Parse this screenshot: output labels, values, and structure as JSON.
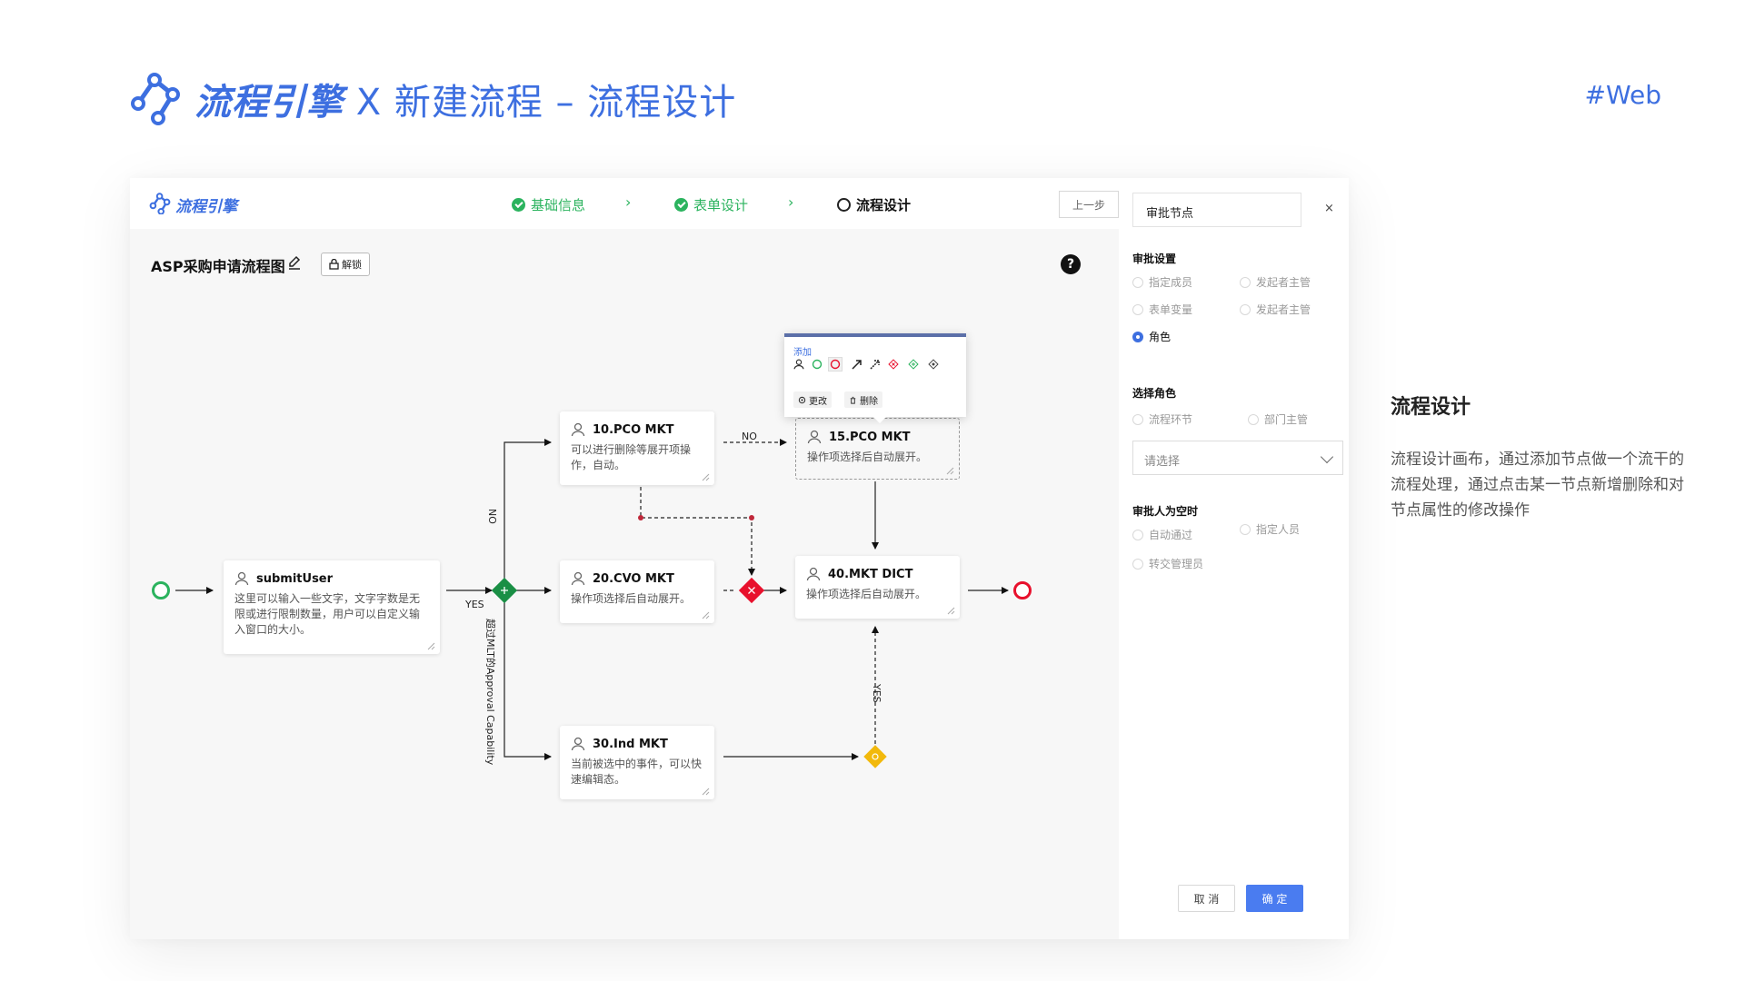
{
  "header": {
    "brand": "流程引擎",
    "title_rest": " X 新建流程 – 流程设计",
    "tag": "#Web"
  },
  "topbar": {
    "brand": "流程引擎",
    "steps": [
      {
        "label": "基础信息",
        "state": "done"
      },
      {
        "label": "表单设计",
        "state": "done"
      },
      {
        "label": "流程设计",
        "state": "current"
      }
    ],
    "step_separator": "›",
    "prev_button": "上一步"
  },
  "toolbar": {
    "flow_title": "ASP采购申请流程图",
    "unlock_label": "解锁",
    "help": "?"
  },
  "nodes": {
    "submit": {
      "title": "submitUser",
      "desc": "这里可以输入一些文字，文字字数是无限或进行限制数量，用户可以自定义输入窗口的大小。"
    },
    "n10": {
      "title": "10.PCO MKT",
      "desc": "可以进行删除等展开项操作，自动。"
    },
    "n15": {
      "title": "15.PCO MKT",
      "desc": "操作项选择后自动展开。"
    },
    "n20": {
      "title": "20.CVO MKT",
      "desc": "操作项选择后自动展开。"
    },
    "n30": {
      "title": "30.Ind MKT",
      "desc": "当前被选中的事件，可以快速编辑态。"
    },
    "n40": {
      "title": "40.MKT DICT",
      "desc": "操作项选择后自动展开。"
    }
  },
  "edge_labels": {
    "no_top": "NO",
    "no_vertical": "NO",
    "yes_main": "YES",
    "yes_right": "YES",
    "approval": "超过MLT的Approval Capability"
  },
  "popover": {
    "title": "添加",
    "change_label": "更改",
    "delete_label": "删除"
  },
  "panel": {
    "node_name": "审批节点",
    "close": "×",
    "approval_settings": "审批设置",
    "approval_options": [
      {
        "label": "指定成员",
        "checked": false
      },
      {
        "label": "发起者主管",
        "checked": false
      },
      {
        "label": "表单变量",
        "checked": false
      },
      {
        "label": "发起者主管",
        "checked": false
      },
      {
        "label": "角色",
        "checked": true
      }
    ],
    "select_role": "选择角色",
    "role_options": [
      {
        "label": "流程环节",
        "checked": false
      },
      {
        "label": "部门主管",
        "checked": false
      }
    ],
    "select_placeholder": "请选择",
    "empty_approver": "审批人为空时",
    "empty_options": [
      {
        "label": "自动通过",
        "checked": false
      },
      {
        "label": "指定人员",
        "checked": false
      },
      {
        "label": "转交管理员",
        "checked": false
      }
    ],
    "cancel": "取 消",
    "confirm": "确 定"
  },
  "description": {
    "title": "流程设计",
    "body": "流程设计画布，通过添加节点做一个流干的流程处理，通过点击某一节点新增删除和对节点属性的修改操作"
  },
  "colors": {
    "brand_blue": "#3d6fe0",
    "start_green": "#2bb35e",
    "end_red": "#e8112d",
    "gateway_green": "#1a8f45",
    "gateway_red": "#e8112d",
    "gateway_yellow": "#f2b90c",
    "confirm_blue": "#4a7cf0"
  }
}
